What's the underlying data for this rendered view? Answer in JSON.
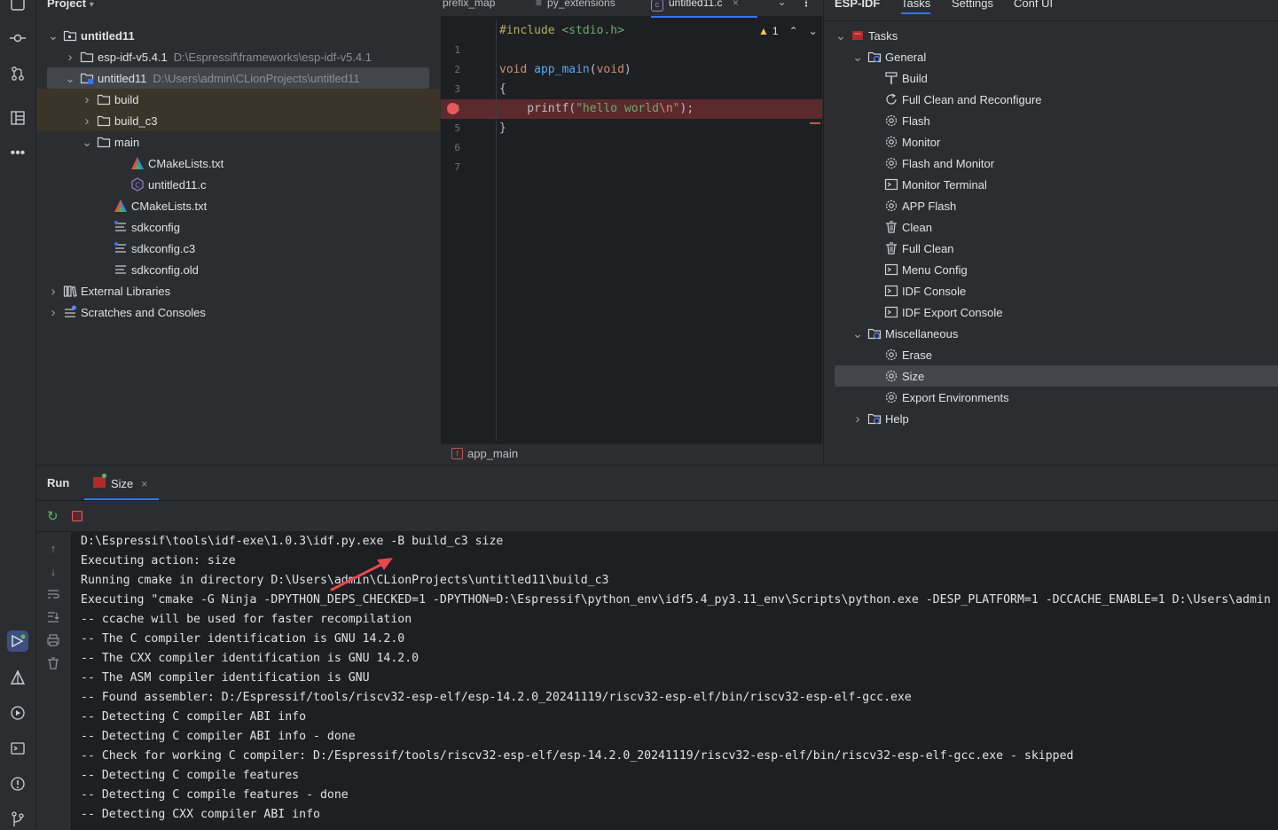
{
  "project": {
    "title": "Project",
    "tree": [
      {
        "label": "untitled11",
        "bold": true,
        "chev": "v",
        "icon": "project-folder-icon",
        "depth": 0
      },
      {
        "label": "esp-idf-v5.4.1",
        "path": "D:\\Espressif\\frameworks\\esp-idf-v5.4.1",
        "chev": ">",
        "icon": "folder-icon",
        "depth": 1
      },
      {
        "label": "untitled11",
        "path": "D:\\Users\\admin\\CLionProjects\\untitled11",
        "chev": "v",
        "icon": "module-folder-icon",
        "depth": 1,
        "selected": true
      },
      {
        "label": "build",
        "chev": ">",
        "icon": "folder-icon",
        "depth": 2,
        "excluded": true
      },
      {
        "label": "build_c3",
        "chev": ">",
        "icon": "folder-icon",
        "depth": 2,
        "excluded": true
      },
      {
        "label": "main",
        "chev": "v",
        "icon": "folder-icon",
        "depth": 2
      },
      {
        "label": "CMakeLists.txt",
        "icon": "cmake-icon",
        "depth": 4
      },
      {
        "label": "untitled11.c",
        "icon": "c-file-icon",
        "depth": 4
      },
      {
        "label": "CMakeLists.txt",
        "icon": "cmake-icon",
        "depth": 3
      },
      {
        "label": "sdkconfig",
        "icon": "config-file-icon",
        "depth": 3
      },
      {
        "label": "sdkconfig.c3",
        "icon": "config-file-icon",
        "depth": 3
      },
      {
        "label": "sdkconfig.old",
        "icon": "text-file-icon",
        "depth": 3
      },
      {
        "label": "External Libraries",
        "chev": ">",
        "icon": "library-icon",
        "depth": 0
      },
      {
        "label": "Scratches and Consoles",
        "chev": ">",
        "icon": "scratches-icon",
        "depth": 0
      }
    ]
  },
  "editor": {
    "tabs": [
      {
        "label": "prefix_map",
        "icon": ""
      },
      {
        "label": "py_extensions",
        "icon": "≡"
      },
      {
        "label": "untitled11.c",
        "icon": "c",
        "active": true
      }
    ],
    "warning_count": "1",
    "lines": [
      {
        "n": "1",
        "tokens": [
          {
            "t": "#include ",
            "c": "#b3ae60"
          },
          {
            "t": "<stdio.h>",
            "c": "#6aab73"
          }
        ]
      },
      {
        "n": "2",
        "tokens": []
      },
      {
        "n": "3",
        "tokens": [
          {
            "t": "void ",
            "c": "#cf8e6d"
          },
          {
            "t": "app_main",
            "c": "#56a8f5"
          },
          {
            "t": "(",
            "c": "#bcbec4"
          },
          {
            "t": "void",
            "c": "#cf8e6d"
          },
          {
            "t": ")",
            "c": "#bcbec4"
          }
        ]
      },
      {
        "n": "4",
        "tokens": [
          {
            "t": "{",
            "c": "#bcbec4"
          }
        ]
      },
      {
        "n": "5",
        "tokens": [
          {
            "t": "    printf(",
            "c": "#bcbec4"
          },
          {
            "t": "\"hello world",
            "c": "#6aab73"
          },
          {
            "t": "\\n",
            "c": "#cf8e6d"
          },
          {
            "t": "\"",
            "c": "#6aab73"
          },
          {
            "t": ");",
            "c": "#bcbec4"
          }
        ]
      },
      {
        "n": "6",
        "tokens": [
          {
            "t": "}",
            "c": "#bcbec4"
          }
        ]
      },
      {
        "n": "7",
        "tokens": []
      }
    ],
    "breadcrumb": "app_main"
  },
  "idf": {
    "title": "ESP-IDF",
    "tabs": [
      "Tasks",
      "Settings",
      "Conf UI"
    ],
    "tree": [
      {
        "label": "Tasks",
        "chev": "v",
        "icon": "esp-icon",
        "depth": 0
      },
      {
        "label": "General",
        "chev": "v",
        "icon": "task-folder-icon",
        "depth": 1
      },
      {
        "label": "Build",
        "icon": "hammer-icon",
        "depth": 2
      },
      {
        "label": "Full Clean and Reconfigure",
        "icon": "refresh-icon",
        "depth": 2
      },
      {
        "label": "Flash",
        "icon": "gear-icon",
        "depth": 2
      },
      {
        "label": "Monitor",
        "icon": "gear-icon",
        "depth": 2
      },
      {
        "label": "Flash and Monitor",
        "icon": "gear-icon",
        "depth": 2
      },
      {
        "label": "Monitor Terminal",
        "icon": "terminal-icon",
        "depth": 2
      },
      {
        "label": "APP Flash",
        "icon": "gear-icon",
        "depth": 2
      },
      {
        "label": "Clean",
        "icon": "trash-icon",
        "depth": 2
      },
      {
        "label": "Full Clean",
        "icon": "trash-icon",
        "depth": 2
      },
      {
        "label": "Menu Config",
        "icon": "terminal-icon",
        "depth": 2
      },
      {
        "label": "IDF Console",
        "icon": "terminal-icon",
        "depth": 2
      },
      {
        "label": "IDF Export Console",
        "icon": "terminal-icon",
        "depth": 2
      },
      {
        "label": "Miscellaneous",
        "chev": "v",
        "icon": "task-folder-icon",
        "depth": 1
      },
      {
        "label": "Erase",
        "icon": "gear-icon",
        "depth": 2
      },
      {
        "label": "Size",
        "icon": "gear-icon",
        "depth": 2,
        "selected": true
      },
      {
        "label": "Export Environments",
        "icon": "gear-icon",
        "depth": 2
      },
      {
        "label": "Help",
        "chev": ">",
        "icon": "task-folder-icon",
        "depth": 1
      }
    ]
  },
  "run": {
    "title": "Run",
    "tab_label": "Size",
    "console": [
      "D:\\Espressif\\tools\\idf-exe\\1.0.3\\idf.py.exe -B build_c3 size",
      "Executing action: size",
      "Running cmake in directory D:\\Users\\admin\\CLionProjects\\untitled11\\build_c3",
      "Executing \"cmake -G Ninja -DPYTHON_DEPS_CHECKED=1 -DPYTHON=D:\\Espressif\\python_env\\idf5.4_py3.11_env\\Scripts\\python.exe -DESP_PLATFORM=1 -DCCACHE_ENABLE=1 D:\\Users\\admin",
      "-- ccache will be used for faster recompilation",
      "-- The C compiler identification is GNU 14.2.0",
      "-- The CXX compiler identification is GNU 14.2.0",
      "-- The ASM compiler identification is GNU",
      "-- Found assembler: D:/Espressif/tools/riscv32-esp-elf/esp-14.2.0_20241119/riscv32-esp-elf/bin/riscv32-esp-elf-gcc.exe",
      "-- Detecting C compiler ABI info",
      "-- Detecting C compiler ABI info - done",
      "-- Check for working C compiler: D:/Espressif/tools/riscv32-esp-elf/esp-14.2.0_20241119/riscv32-esp-elf/bin/riscv32-esp-elf-gcc.exe - skipped",
      "-- Detecting C compile features",
      "-- Detecting C compile features - done",
      "-- Detecting CXX compiler ABI info"
    ]
  },
  "colors": {
    "accent": "#3574f0",
    "arrow": "#e8474b",
    "breakpoint": "#e55b5b"
  }
}
